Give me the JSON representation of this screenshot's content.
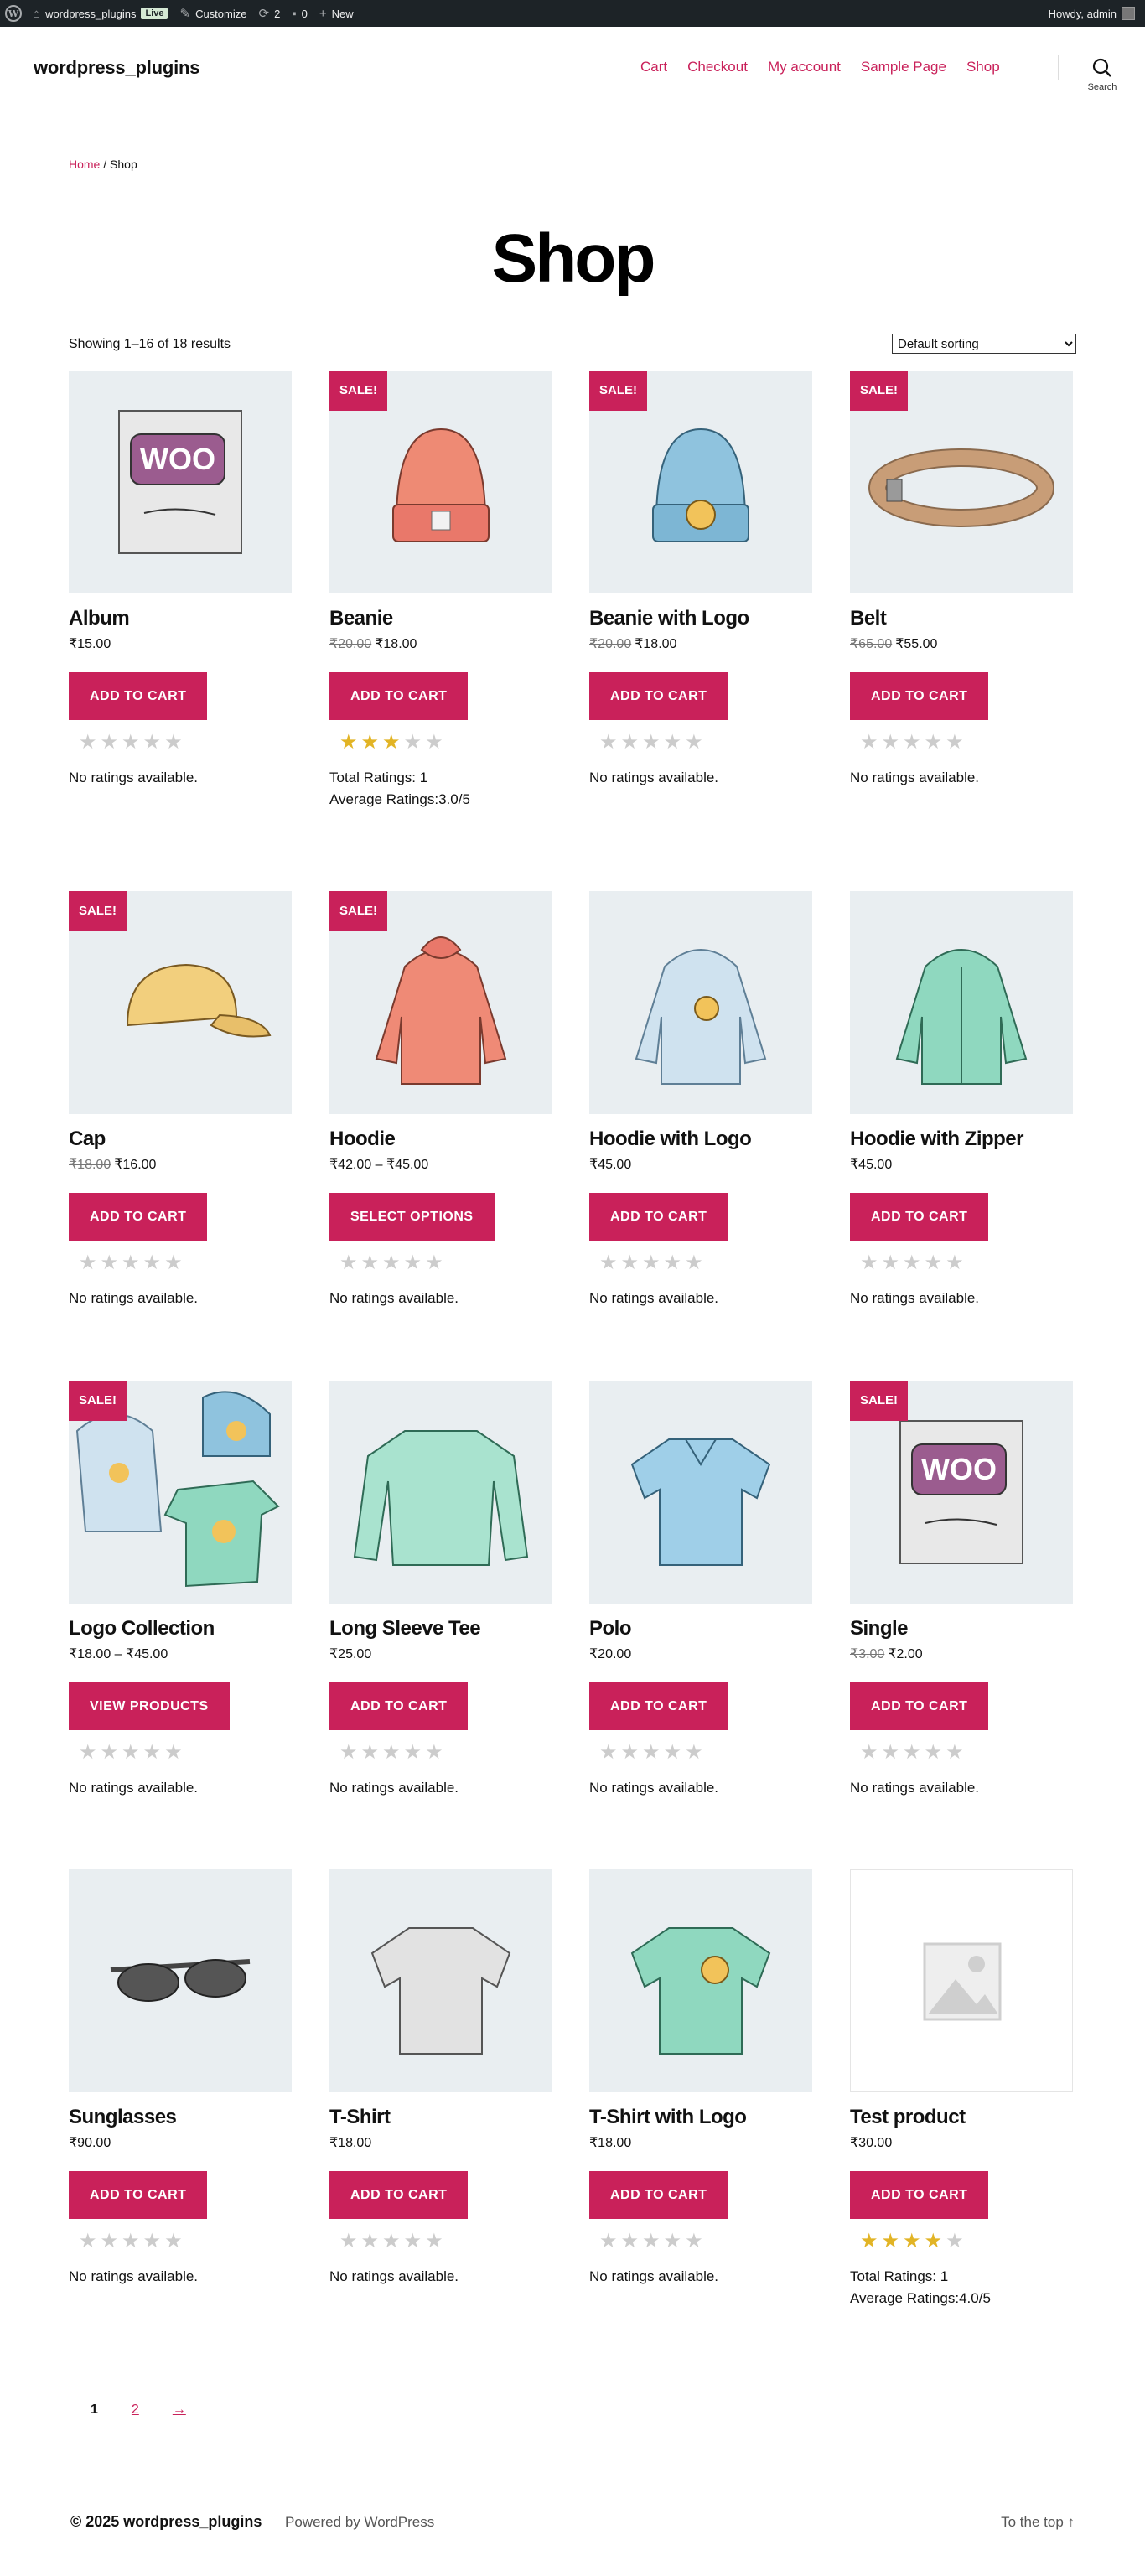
{
  "admin_bar": {
    "site_name": "wordpress_plugins",
    "live_badge": "Live",
    "customize": "Customize",
    "updates_count": "2",
    "comments_count": "0",
    "new_label": "New",
    "howdy": "Howdy, admin"
  },
  "header": {
    "site_title": "wordpress_plugins",
    "nav": [
      "Cart",
      "Checkout",
      "My account",
      "Sample Page",
      "Shop"
    ],
    "search_label": "Search"
  },
  "breadcrumb": {
    "home": "Home",
    "separator": " / ",
    "current": "Shop"
  },
  "page_title": "Shop",
  "result_count": "Showing 1–16 of 18 results",
  "sorting": {
    "selected": "Default sorting"
  },
  "products": [
    {
      "name": "Album",
      "sale": false,
      "old_price": "",
      "price": "₹15.00",
      "button": "ADD TO CART",
      "rating": 0,
      "rating_text": [
        "No ratings available."
      ],
      "icon": "album-icon"
    },
    {
      "name": "Beanie",
      "sale": true,
      "old_price": "₹20.00",
      "price": "₹18.00",
      "button": "ADD TO CART",
      "rating": 3,
      "rating_text": [
        "Total Ratings: 1",
        "Average Ratings:3.0/5"
      ],
      "icon": "beanie-icon"
    },
    {
      "name": "Beanie with Logo",
      "sale": true,
      "old_price": "₹20.00",
      "price": "₹18.00",
      "button": "ADD TO CART",
      "rating": 0,
      "rating_text": [
        "No ratings available."
      ],
      "icon": "beanie-logo-icon"
    },
    {
      "name": "Belt",
      "sale": true,
      "old_price": "₹65.00",
      "price": "₹55.00",
      "button": "ADD TO CART",
      "rating": 0,
      "rating_text": [
        "No ratings available."
      ],
      "icon": "belt-icon"
    },
    {
      "name": "Cap",
      "sale": true,
      "old_price": "₹18.00",
      "price": "₹16.00",
      "button": "ADD TO CART",
      "rating": 0,
      "rating_text": [
        "No ratings available."
      ],
      "icon": "cap-icon"
    },
    {
      "name": "Hoodie",
      "sale": true,
      "old_price": "",
      "price": "₹42.00 – ₹45.00",
      "button": "SELECT OPTIONS",
      "rating": 0,
      "rating_text": [
        "No ratings available."
      ],
      "icon": "hoodie-icon"
    },
    {
      "name": "Hoodie with Logo",
      "sale": false,
      "old_price": "",
      "price": "₹45.00",
      "button": "ADD TO CART",
      "rating": 0,
      "rating_text": [
        "No ratings available."
      ],
      "icon": "hoodie-logo-icon"
    },
    {
      "name": "Hoodie with Zipper",
      "sale": false,
      "old_price": "",
      "price": "₹45.00",
      "button": "ADD TO CART",
      "rating": 0,
      "rating_text": [
        "No ratings available."
      ],
      "icon": "hoodie-zipper-icon"
    },
    {
      "name": "Logo Collection",
      "sale": true,
      "old_price": "",
      "price": "₹18.00 – ₹45.00",
      "button": "VIEW PRODUCTS",
      "rating": 0,
      "rating_text": [
        "No ratings available."
      ],
      "icon": "logo-collection-icon"
    },
    {
      "name": "Long Sleeve Tee",
      "sale": false,
      "old_price": "",
      "price": "₹25.00",
      "button": "ADD TO CART",
      "rating": 0,
      "rating_text": [
        "No ratings available."
      ],
      "icon": "long-sleeve-tee-icon"
    },
    {
      "name": "Polo",
      "sale": false,
      "old_price": "",
      "price": "₹20.00",
      "button": "ADD TO CART",
      "rating": 0,
      "rating_text": [
        "No ratings available."
      ],
      "icon": "polo-icon"
    },
    {
      "name": "Single",
      "sale": true,
      "old_price": "₹3.00",
      "price": "₹2.00",
      "button": "ADD TO CART",
      "rating": 0,
      "rating_text": [
        "No ratings available."
      ],
      "icon": "single-icon"
    },
    {
      "name": "Sunglasses",
      "sale": false,
      "old_price": "",
      "price": "₹90.00",
      "button": "ADD TO CART",
      "rating": 0,
      "rating_text": [
        "No ratings available."
      ],
      "icon": "sunglasses-icon"
    },
    {
      "name": "T-Shirt",
      "sale": false,
      "old_price": "",
      "price": "₹18.00",
      "button": "ADD TO CART",
      "rating": 0,
      "rating_text": [
        "No ratings available."
      ],
      "icon": "tshirt-icon"
    },
    {
      "name": "T-Shirt with Logo",
      "sale": false,
      "old_price": "",
      "price": "₹18.00",
      "button": "ADD TO CART",
      "rating": 0,
      "rating_text": [
        "No ratings available."
      ],
      "icon": "tshirt-logo-icon"
    },
    {
      "name": "Test product",
      "sale": false,
      "old_price": "",
      "price": "₹30.00",
      "button": "ADD TO CART",
      "rating": 4,
      "rating_text": [
        "Total Ratings: 1",
        "Average Ratings:4.0/5"
      ],
      "icon": "placeholder-image-icon"
    }
  ],
  "sale_label": "SALE!",
  "pagination": {
    "current": "1",
    "next_page": "2",
    "next_arrow": "→"
  },
  "footer": {
    "copyright": "© 2025 wordpress_plugins",
    "powered_by": "Powered by WordPress",
    "to_top": "To the top ↑"
  },
  "colors": {
    "accent": "#c9215a",
    "admin_bar": "#1d2327",
    "star_on": "#e2b425",
    "star_off": "#cccccc"
  }
}
